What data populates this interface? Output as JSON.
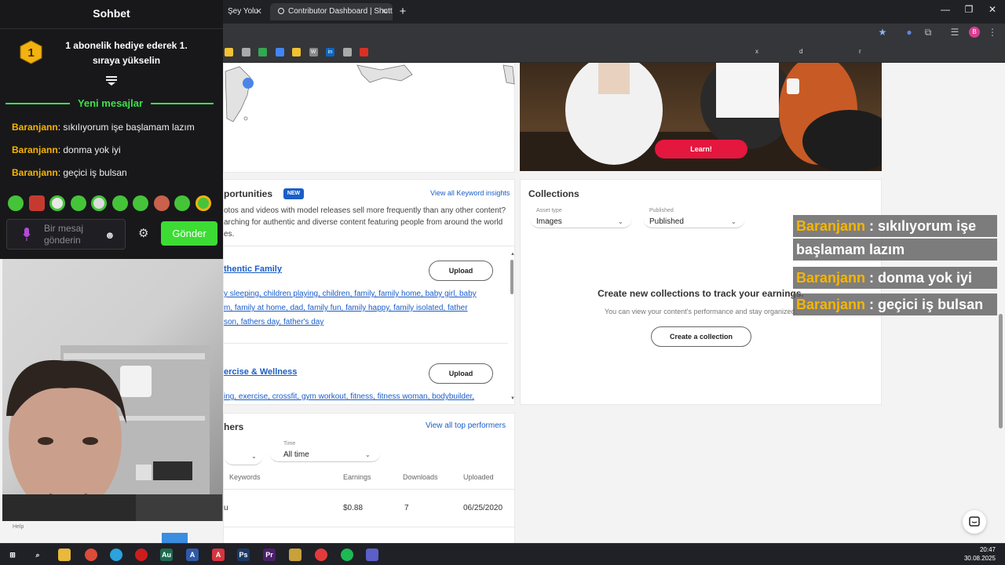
{
  "browser": {
    "tabs": [
      {
        "label": "Şey Yolu",
        "active": false
      },
      {
        "label": "Contributor Dashboard | Shutte",
        "active": true
      }
    ],
    "new_tab": "+",
    "window_controls": [
      "—",
      "❐",
      "✕"
    ]
  },
  "bookmarks": [
    {
      "label": "",
      "color": "#f2c230"
    },
    {
      "label": "",
      "color": "#aaaaaa"
    },
    {
      "label": "",
      "color": "#33a852"
    },
    {
      "label": "",
      "color": "#4285f4"
    },
    {
      "label": "",
      "color": "#f2c230"
    },
    {
      "label": "W",
      "color": "#888888"
    },
    {
      "label": "in",
      "color": "#0a66c2"
    },
    {
      "label": "",
      "color": "#aaaaaa"
    },
    {
      "label": "",
      "color": "#d93025"
    }
  ],
  "bookmark_folders": [
    "x",
    "d",
    "r"
  ],
  "chat": {
    "title": "Sohbet",
    "promo": "1 abonelik hediye ederek 1. sıraya yükselin",
    "badge_number": "1",
    "new_messages_label": "Yeni mesajlar",
    "messages": [
      {
        "user": "Baranjann",
        "text": ": sıkılıyorum işe başlamam lazım"
      },
      {
        "user": "Baranjann",
        "text": ": donma yok iyi"
      },
      {
        "user": "Baranjann",
        "text": ": geçici iş bulsan"
      }
    ],
    "input_placeholder": "Bir mesaj gönderin",
    "send_label": "Gönder"
  },
  "overlay_messages": [
    {
      "user": "Baranjann",
      "text": " : sıkılıyorum işe",
      "continued": "başlamam lazım"
    },
    {
      "user": "Baranjann",
      "text": " : donma yok iyi"
    },
    {
      "user": "Baranjann",
      "text": " : geçici iş bulsan"
    }
  ],
  "learn_button": "Learn!",
  "opportunities": {
    "title": "portunities",
    "badge": "NEW",
    "view_all": "View all Keyword insights",
    "desc_line1": "otos and videos with model releases sell more frequently than any other content?",
    "desc_line2": "arching for authentic and diverse content featuring people from around the world",
    "desc_line3": "es.",
    "items": [
      {
        "title": "thentic Family",
        "upload": "Upload",
        "tags": [
          [
            "y sleeping, ",
            "children playing, ",
            "children, ",
            "family, ",
            "family home, ",
            "baby girl, ",
            "baby"
          ],
          [
            "m, ",
            "family at home, ",
            "dad, ",
            "family fun, ",
            "family happy, ",
            "family isolated, ",
            "father"
          ],
          [
            "son, ",
            "fathers day, ",
            "father's day"
          ]
        ]
      },
      {
        "title": "ercise & Wellness",
        "upload": "Upload",
        "tags": [
          [
            "ing, ",
            "exercise, ",
            "crossfit, ",
            "gym workout, ",
            "fitness, ",
            "fitness woman, ",
            "bodybuilder,"
          ]
        ]
      }
    ]
  },
  "collections": {
    "title": "Collections",
    "asset_type_label": "Asset type",
    "asset_type_value": "Images",
    "published_label": "Published",
    "published_value": "Published",
    "empty_title": "Create new collections to track your earnings.",
    "empty_desc": "You can view your content's performance and stay organized.",
    "create_button": "Create a collection"
  },
  "top_performers": {
    "title": "hers",
    "view_all": "View all top performers",
    "time_label": "Time",
    "time_value": "All time",
    "columns": [
      "Keywords",
      "Earnings",
      "Downloads",
      "Uploaded"
    ],
    "rows": [
      {
        "keywords": "u",
        "earnings": "$0.88",
        "downloads": "7",
        "uploaded": "06/25/2020"
      }
    ]
  },
  "taskbar": {
    "help": "Help",
    "time": "20:47",
    "date": "30.08.2025"
  }
}
